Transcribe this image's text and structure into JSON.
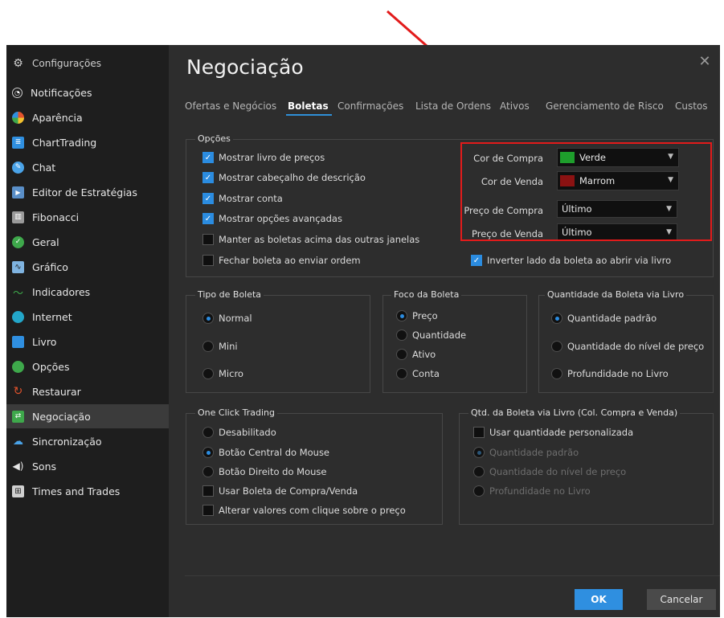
{
  "sidebar": {
    "header": "Configurações",
    "items": [
      {
        "label": "Notificações",
        "icon": "bell-icon"
      },
      {
        "label": "Aparência",
        "icon": "palette-icon"
      },
      {
        "label": "ChartTrading",
        "icon": "chart-trading-icon"
      },
      {
        "label": "Chat",
        "icon": "chat-icon"
      },
      {
        "label": "Editor de Estratégias",
        "icon": "strategy-editor-icon"
      },
      {
        "label": "Fibonacci",
        "icon": "fibonacci-icon"
      },
      {
        "label": "Geral",
        "icon": "check-circle-icon"
      },
      {
        "label": "Gráfico",
        "icon": "chart-icon"
      },
      {
        "label": "Indicadores",
        "icon": "indicator-icon"
      },
      {
        "label": "Internet",
        "icon": "globe-icon"
      },
      {
        "label": "Livro",
        "icon": "book-icon"
      },
      {
        "label": "Opções",
        "icon": "options-icon"
      },
      {
        "label": "Restaurar",
        "icon": "restore-icon"
      },
      {
        "label": "Negociação",
        "icon": "trade-icon"
      },
      {
        "label": "Sincronização",
        "icon": "cloud-icon"
      },
      {
        "label": "Sons",
        "icon": "speaker-icon"
      },
      {
        "label": "Times and Trades",
        "icon": "times-trades-icon"
      }
    ],
    "active": "Negociação"
  },
  "dialog": {
    "title": "Negociação",
    "close": "✕",
    "tabs": [
      "Ofertas e Negócios",
      "Boletas",
      "Confirmações",
      "Lista de Ordens",
      "Ativos",
      "Gerenciamento de Risco",
      "Custos"
    ],
    "active_tab": "Boletas"
  },
  "opcoes": {
    "label": "Opções",
    "checks": [
      {
        "label": "Mostrar livro de preços",
        "checked": true
      },
      {
        "label": "Mostrar cabeçalho de descrição",
        "checked": true
      },
      {
        "label": "Mostrar conta",
        "checked": true
      },
      {
        "label": "Mostrar opções avançadas",
        "checked": true
      },
      {
        "label": "Manter as boletas acima das outras janelas",
        "checked": false
      },
      {
        "label": "Fechar boleta ao enviar ordem",
        "checked": false
      }
    ],
    "fields": [
      {
        "label": "Cor de Compra",
        "value": "Verde",
        "color": "#1e9e2c"
      },
      {
        "label": "Cor de Venda",
        "value": "Marrom",
        "color": "#8b1212"
      },
      {
        "label": "Preço de Compra",
        "value": "Último"
      },
      {
        "label": "Preço de Venda",
        "value": "Último"
      }
    ],
    "invert": {
      "label": "Inverter lado da boleta ao abrir via livro",
      "checked": true
    }
  },
  "tipo_boleta": {
    "label": "Tipo de Boleta",
    "options": [
      "Normal",
      "Mini",
      "Micro"
    ],
    "selected": "Normal"
  },
  "foco_boleta": {
    "label": "Foco da Boleta",
    "options": [
      "Preço",
      "Quantidade",
      "Ativo",
      "Conta"
    ],
    "selected": "Preço"
  },
  "quantidade_livro": {
    "label": "Quantidade da Boleta via Livro",
    "options": [
      "Quantidade padrão",
      "Quantidade do nível de preço",
      "Profundidade no Livro"
    ],
    "selected": "Quantidade padrão"
  },
  "one_click": {
    "label": "One Click Trading",
    "options": [
      "Desabilitado",
      "Botão Central do Mouse",
      "Botão Direito do Mouse"
    ],
    "selected": "Botão Central do Mouse",
    "checks": [
      {
        "label": "Usar Boleta de Compra/Venda",
        "checked": false
      },
      {
        "label": "Alterar valores com clique sobre o preço",
        "checked": false
      }
    ]
  },
  "qtd_livro_col": {
    "label": "Qtd. da Boleta via Livro  (Col. Compra e Venda)",
    "check": {
      "label": "Usar quantidade personalizada",
      "checked": false
    },
    "options": [
      "Quantidade padrão",
      "Quantidade do nível de preço",
      "Profundidade no Livro"
    ],
    "selected": "Quantidade padrão"
  },
  "footer": {
    "ok": "OK",
    "cancel": "Cancelar"
  },
  "colors": {
    "accent": "#2f8fe0",
    "highlight": "#e21b1b"
  }
}
